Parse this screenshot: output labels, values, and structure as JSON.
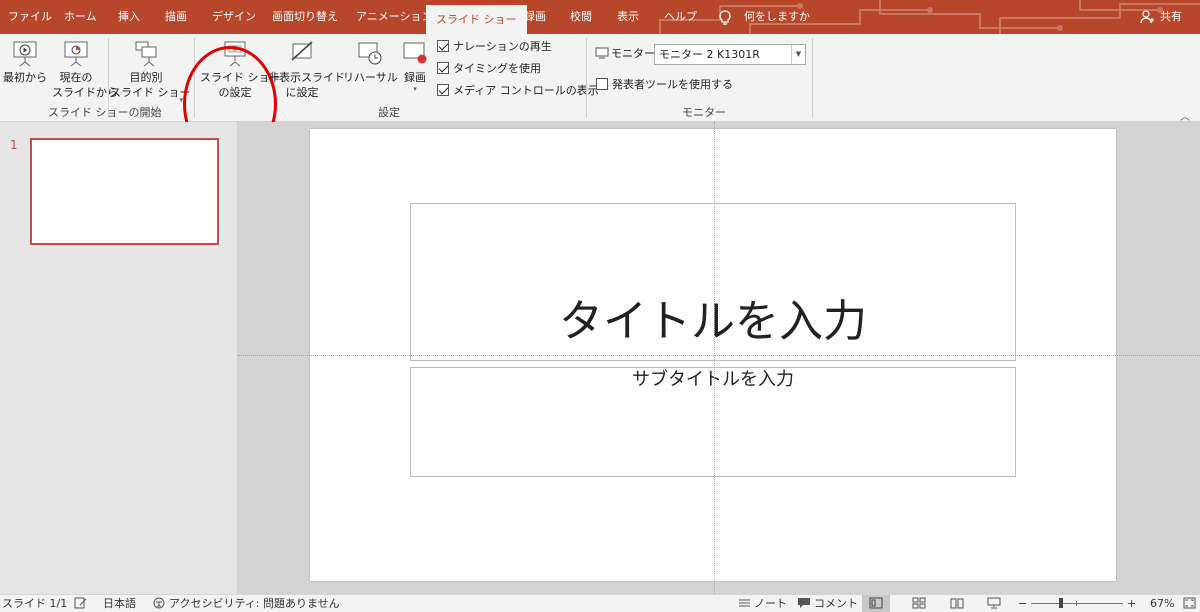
{
  "tabs": [
    {
      "label": "ファイル",
      "active": false
    },
    {
      "label": "ホーム",
      "active": false
    },
    {
      "label": "挿入",
      "active": false
    },
    {
      "label": "描画",
      "active": false
    },
    {
      "label": "デザイン",
      "active": false
    },
    {
      "label": "画面切り替え",
      "active": false
    },
    {
      "label": "アニメーション",
      "active": false
    },
    {
      "label": "スライド ショー",
      "active": true
    },
    {
      "label": "録画",
      "active": false
    },
    {
      "label": "校閲",
      "active": false
    },
    {
      "label": "表示",
      "active": false
    },
    {
      "label": "ヘルプ",
      "active": false
    }
  ],
  "tell_me": "何をしますか",
  "share": "共有",
  "ribbon": {
    "start": {
      "from_beginning": "最初から",
      "from_current_l1": "現在の",
      "from_current_l2": "スライドから",
      "custom_l1": "目的別",
      "custom_l2": "スライド ショー",
      "group": "スライド ショーの開始"
    },
    "setup": {
      "setup_l1": "スライド ショー",
      "setup_l2": "の設定",
      "hide_l1": "非表示スライド",
      "hide_l2": "に設定",
      "rehearse": "リハーサル",
      "record": "録画",
      "cb_narration": "ナレーションの再生",
      "cb_timing": "タイミングを使用",
      "cb_media": "メディア コントロールの表示",
      "group": "設定"
    },
    "monitor": {
      "label": "モニター:",
      "value": "モニター 2 K1301R",
      "presenter": "発表者ツールを使用する",
      "group": "モニター"
    }
  },
  "thumbnail_number": "1",
  "slide": {
    "title": "タイトルを入力",
    "subtitle": "サブタイトルを入力"
  },
  "status": {
    "slide_count": "スライド 1/1",
    "language": "日本語",
    "accessibility": "アクセシビリティ: 問題ありません",
    "notes": "ノート",
    "comments": "コメント",
    "zoom_minus": "−",
    "zoom_plus": "+",
    "zoom_level": "67%"
  },
  "colors": {
    "accent": "#b7472a",
    "annotation": "#e00000"
  }
}
